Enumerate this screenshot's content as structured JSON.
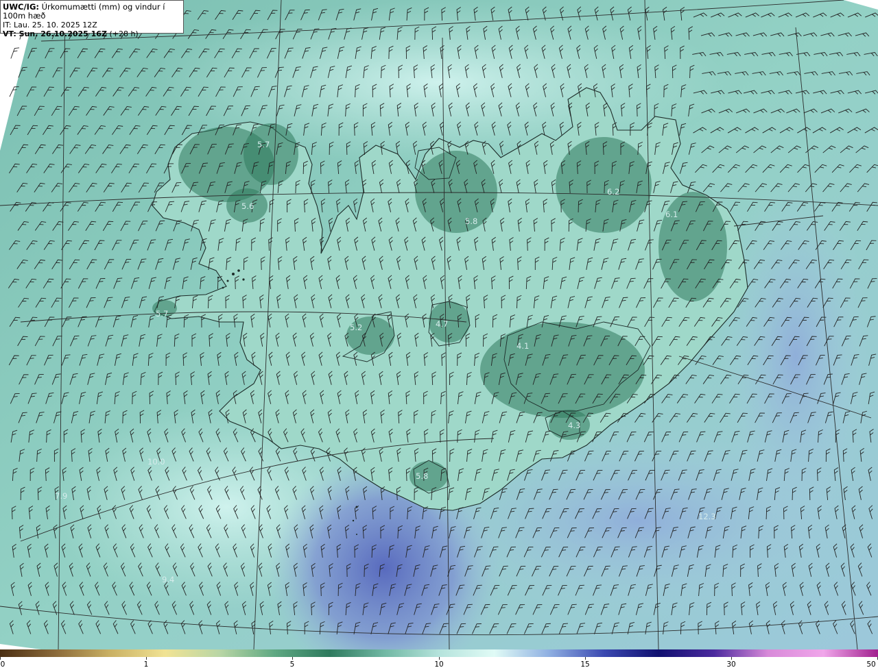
{
  "header": {
    "model": "UWC/IG:",
    "title": "Úrkomumætti (mm) og vindur í 100m hæð",
    "issue_time": "IT: Lau. 25. 10. 2025 12Z",
    "valid_prefix": "VT: Sun. 26.10.2025 16Z",
    "valid_offset": "(+28 h)"
  },
  "colorbar": {
    "ticks": [
      "0",
      "1",
      "5",
      "10",
      "15",
      "30",
      "50"
    ],
    "colors": [
      "#4a2e12",
      "#8b6a3a",
      "#c9b063",
      "#f1e394",
      "#b9d6a5",
      "#5ea882",
      "#2e7a5e",
      "#71b8a4",
      "#b5e3dc",
      "#e0fbf6",
      "#8fb0e2",
      "#3b49b1",
      "#101070",
      "#4b2a9e",
      "#d88ad9",
      "#f0a6ea",
      "#a1208e"
    ]
  },
  "map": {
    "land_colors": {
      "ocean": "#87c9bd",
      "land_low": "#a7dccf",
      "land_high": "#2f7a5c",
      "south_sea": "#7887cc"
    },
    "values": [
      "5.7",
      "5.6",
      "5.7",
      "5.2",
      "4.7",
      "5.8",
      "6.2",
      "6.1",
      "4.1",
      "4.3",
      "5.8",
      "10.0",
      "7.9",
      "9.4",
      "12.3"
    ]
  }
}
